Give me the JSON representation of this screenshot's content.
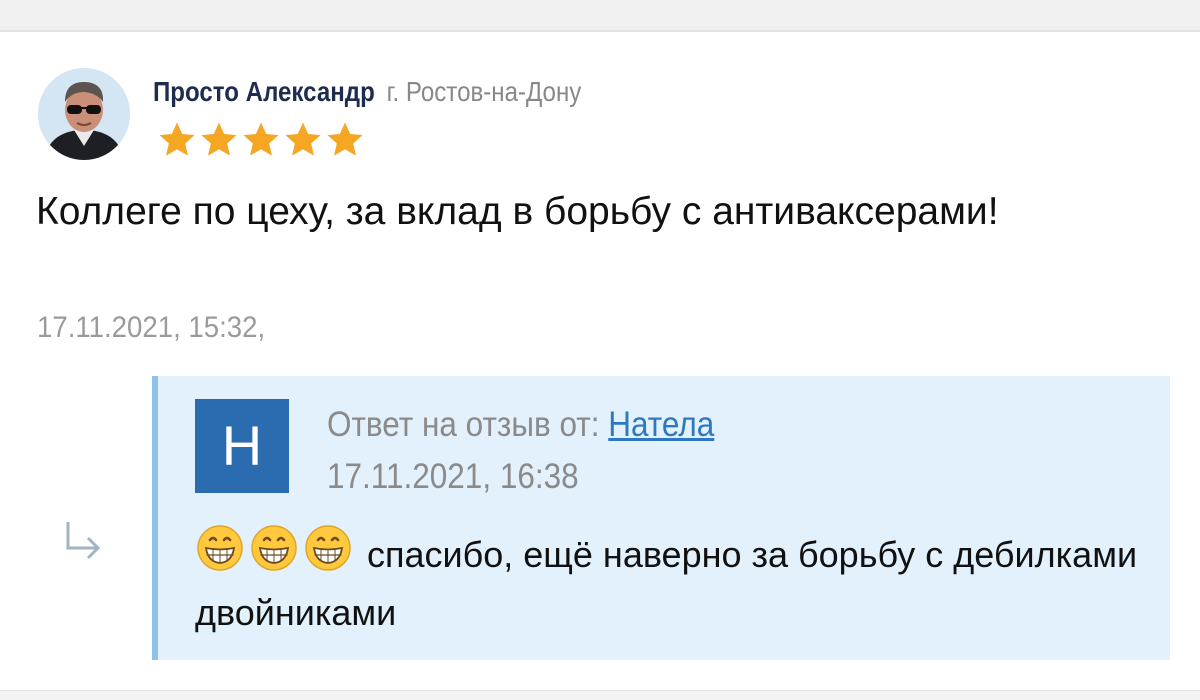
{
  "review": {
    "author_name": "Просто Александр",
    "author_city": "г. Ростов-на-Дону",
    "rating": 5,
    "rating_max": 5,
    "text": "Коллеге по цеху, за вклад в борьбу с антиваксерами!",
    "date": "17.11.2021, 15:32,"
  },
  "reply": {
    "badge_letter": "Н",
    "label": "Ответ на отзыв от:",
    "author_name": "Натела",
    "date": "17.11.2021, 16:38",
    "emojis": [
      "grinning-face-emoji",
      "grinning-face-emoji",
      "grinning-face-emoji"
    ],
    "text": "спасибо, ещё наверно за борьбу с дебилками двойниками"
  },
  "icons": {
    "star": "star-icon",
    "reply_arrow": "reply-arrow-icon"
  },
  "colors": {
    "star": "#f5a623",
    "author_name": "#1e2d4f",
    "reply_background": "#e2f1fb",
    "reply_border": "#8ec2e8",
    "reply_badge": "#2b6cb0",
    "link": "#2d78c2"
  }
}
